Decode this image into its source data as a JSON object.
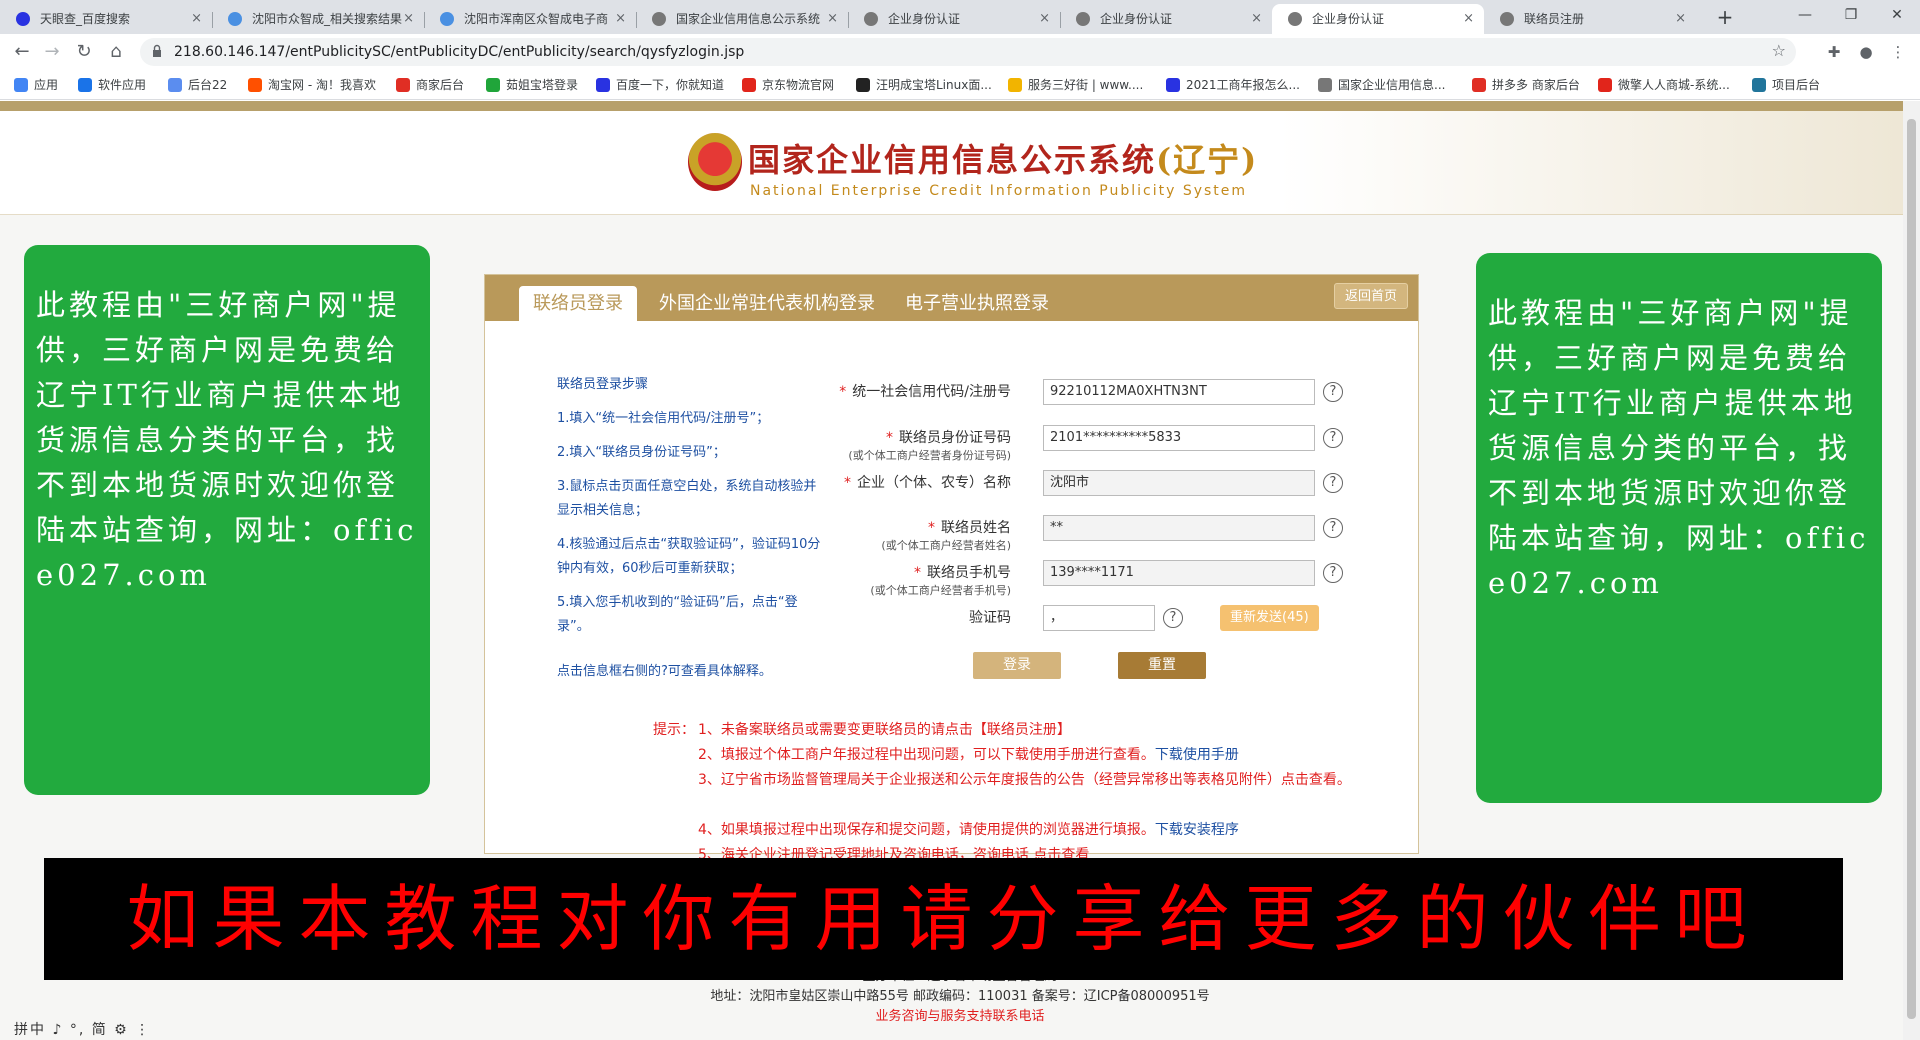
{
  "browser": {
    "tabs": [
      {
        "title": "天眼查_百度搜索",
        "active": false
      },
      {
        "title": "沈阳市众智成_相关搜索结果",
        "active": false
      },
      {
        "title": "沈阳市浑南区众智成电子商",
        "active": false
      },
      {
        "title": "国家企业信用信息公示系统",
        "active": false
      },
      {
        "title": "企业身份认证",
        "active": false
      },
      {
        "title": "企业身份认证",
        "active": false
      },
      {
        "title": "企业身份认证",
        "active": true
      },
      {
        "title": "联络员注册",
        "active": false
      }
    ],
    "close_glyph": "×",
    "new_tab": "+",
    "url": "218.60.146.147/entPublicitySC/entPublicityDC/entPublicity/search/qysfyzlogin.jsp",
    "bookmarks": [
      {
        "label": "应用",
        "color": "#4285f4"
      },
      {
        "label": "软件应用",
        "color": "#1a73e8"
      },
      {
        "label": "后台22",
        "color": "#5b8def"
      },
      {
        "label": "淘宝网 - 淘！我喜欢",
        "color": "#ff5000"
      },
      {
        "label": "商家后台",
        "color": "#e02e24"
      },
      {
        "label": "茹姐宝塔登录",
        "color": "#20a53a"
      },
      {
        "label": "百度一下，你就知道",
        "color": "#2932e1"
      },
      {
        "label": "京东物流官网",
        "color": "#e1251b"
      },
      {
        "label": "汪明成宝塔Linux面...",
        "color": "#222222"
      },
      {
        "label": "服务三好街 | www....",
        "color": "#f2b400"
      },
      {
        "label": "2021工商年报怎么...",
        "color": "#2932e1"
      },
      {
        "label": "国家企业信用信息...",
        "color": "#777777"
      },
      {
        "label": "拼多多 商家后台",
        "color": "#e02e24"
      },
      {
        "label": "微擎人人商城-系统...",
        "color": "#e1251b"
      },
      {
        "label": "项目后台",
        "color": "#21759b"
      }
    ]
  },
  "site": {
    "title_main": "国家企业信用信息公示系统",
    "title_region": "(辽宁)",
    "subtitle": "National Enterprise Credit Information Publicity System"
  },
  "side_note": "此教程由\"三好商户网\"提供，三好商户网是免费给辽宁IT行业商户提供本地货源信息分类的平台，找不到本地货源时欢迎你登陆本站查询，网址：office027.com",
  "panel": {
    "tabs": [
      "联络员登录",
      "外国企业常驻代表机构登录",
      "电子营业执照登录"
    ],
    "home_button": "返回首页",
    "steps_title": "联络员登录步骤",
    "steps": [
      "1.填入“统一社会信用代码/注册号”；",
      "2.填入“联络员身份证号码”；",
      "3.鼠标点击页面任意空白处，系统自动核验并显示相关信息；",
      "4.核验通过后点击“获取验证码”，验证码10分钟内有效，60秒后可重新获取；",
      "5.填入您手机收到的“验证码”后，点击“登录”。"
    ],
    "help_link": "点击信息框右侧的?可查看具体解释。",
    "required_mark": "*",
    "help_glyph": "?",
    "fields": {
      "credit_code": {
        "label": "统一社会信用代码/注册号",
        "value": "92210112MA0XHTN3NT"
      },
      "id_number": {
        "label": "联络员身份证号码",
        "sub": "(或个体工商户经营者身份证号码)",
        "value": "2101**********5833"
      },
      "company": {
        "label": "企业（个体、农专）名称",
        "value": "沈阳市"
      },
      "name": {
        "label": "联络员姓名",
        "sub": "(或个体工商户经营者姓名)",
        "value": "**"
      },
      "phone": {
        "label": "联络员手机号",
        "sub": "(或个体工商户经营者手机号)",
        "value": "139****1171"
      },
      "captcha": {
        "label": "验证码",
        "value": "，"
      }
    },
    "resend_button": "重新发送(45)",
    "login_button": "登录",
    "reset_button": "重置",
    "tips": {
      "label": "提示：",
      "items": [
        {
          "text": "1、未备案联络员或需要变更联络员的请点击",
          "link": "【联络员注册】"
        },
        {
          "text": "2、填报过个体工商户年报过程中出现问题，可以下载使用手册进行查看。",
          "link": "下载使用手册"
        },
        {
          "text": "3、辽宁省市场监督管理局关于企业报送和公示年度报告的公告（经营异常移出等表格见附件）点击查看。",
          "link": ""
        },
        {
          "text": "4、如果填报过程中出现保存和提交问题，请使用提供的浏览器进行填报。",
          "link": "下载安装程序"
        },
        {
          "text": "5、海关企业注册登记受理地址及咨询电话，咨询电话 点击查看",
          "link": ""
        }
      ]
    }
  },
  "footer": {
    "sponsor": "主办单位：辽宁省市场监督管理局",
    "address": "地址：沈阳市皇姑区崇山中路55号 邮政编码：110031 备案号：辽ICP备08000951号",
    "hotline": "业务咨询与服务支持联系电话"
  },
  "banner": "如果本教程对你有用请分享给更多的伙伴吧",
  "ime_status": "拼中 ♪ °, 简 ⚙ ⋮"
}
